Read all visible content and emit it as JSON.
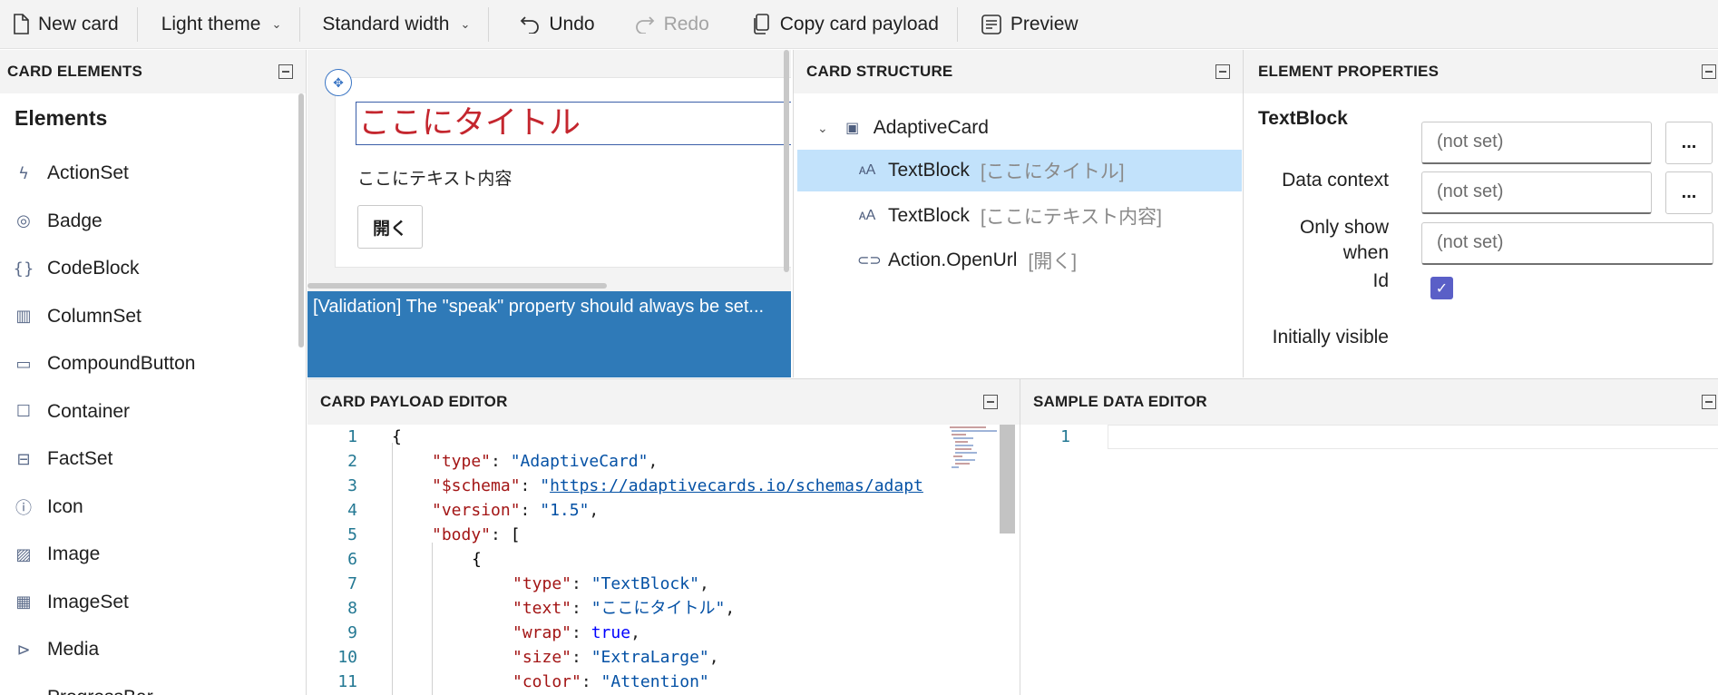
{
  "toolbar": {
    "new_card": "New card",
    "theme": "Light theme",
    "width": "Standard width",
    "undo": "Undo",
    "redo": "Redo",
    "copy_payload": "Copy card payload",
    "preview": "Preview"
  },
  "elements_panel": {
    "title": "CARD ELEMENTS",
    "section": "Elements",
    "items": [
      {
        "label": "ActionSet",
        "icon": "lightning-icon"
      },
      {
        "label": "Badge",
        "icon": "badge-icon"
      },
      {
        "label": "CodeBlock",
        "icon": "braces-icon"
      },
      {
        "label": "ColumnSet",
        "icon": "columns-icon"
      },
      {
        "label": "CompoundButton",
        "icon": "compound-button-icon"
      },
      {
        "label": "Container",
        "icon": "container-icon"
      },
      {
        "label": "FactSet",
        "icon": "factset-icon"
      },
      {
        "label": "Icon",
        "icon": "info-icon"
      },
      {
        "label": "Image",
        "icon": "image-icon"
      },
      {
        "label": "ImageSet",
        "icon": "imageset-icon"
      },
      {
        "label": "Media",
        "icon": "media-icon"
      },
      {
        "label": "ProgressBar",
        "icon": "progressbar-icon"
      }
    ]
  },
  "canvas": {
    "title_text": "ここにタイトル",
    "body_text": "ここにテキスト内容",
    "button_label": "開く",
    "validation": "[Validation] The \"speak\" property should always be set..."
  },
  "structure": {
    "title": "CARD STRUCTURE",
    "root": "AdaptiveCard",
    "nodes": [
      {
        "type": "TextBlock",
        "detail": "[ここにタイトル]",
        "selected": true
      },
      {
        "type": "TextBlock",
        "detail": "[ここにテキスト内容]",
        "selected": false
      },
      {
        "type": "Action.OpenUrl",
        "detail": "[開く]",
        "selected": false
      }
    ]
  },
  "properties": {
    "title": "ELEMENT PROPERTIES",
    "element": "TextBlock",
    "data_context_label": "Data context",
    "data_context_value": "(not set)",
    "only_show_label_1": "Only show",
    "only_show_label_2": "when",
    "only_show_value": "(not set)",
    "id_label": "Id",
    "id_value": "(not set)",
    "initially_visible_label": "Initially visible",
    "initially_visible": true,
    "more": "..."
  },
  "payload_editor": {
    "title": "CARD PAYLOAD EDITOR",
    "lines": [
      {
        "n": "1"
      },
      {
        "n": "2"
      },
      {
        "n": "3"
      },
      {
        "n": "4"
      },
      {
        "n": "5"
      },
      {
        "n": "6"
      },
      {
        "n": "7"
      },
      {
        "n": "8"
      },
      {
        "n": "9"
      },
      {
        "n": "10"
      },
      {
        "n": "11"
      }
    ],
    "tokens": {
      "brace_open": "{",
      "type_key": "\"type\"",
      "type_val": "\"AdaptiveCard\"",
      "schema_key": "\"$schema\"",
      "schema_val": "https://adaptivecards.io/schemas/adapt",
      "version_key": "\"version\"",
      "version_val": "\"1.5\"",
      "body_key": "\"body\"",
      "bracket": "[",
      "inner_brace": "{",
      "tb_type_key": "\"type\"",
      "tb_type_val": "\"TextBlock\"",
      "text_key": "\"text\"",
      "text_val": "\"ここにタイトル\"",
      "wrap_key": "\"wrap\"",
      "wrap_val": "true",
      "size_key": "\"size\"",
      "size_val": "\"ExtraLarge\"",
      "color_key": "\"color\"",
      "color_val": "\"Attention\""
    }
  },
  "sample_editor": {
    "title": "SAMPLE DATA EDITOR",
    "line": "1"
  },
  "colors": {
    "accent": "#2f7ab8",
    "selection": "#c2e2fb",
    "attention": "#c4262e",
    "checkbox": "#5a5fc7"
  }
}
